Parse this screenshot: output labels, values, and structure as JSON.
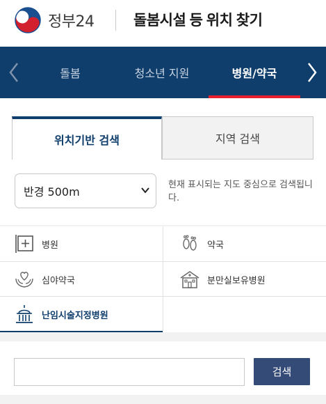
{
  "header": {
    "logo_text": "정부24",
    "title": "돌봄시설 등 위치 찾기"
  },
  "nav": {
    "left_arrow": "chevron-left-icon",
    "right_arrow": "chevron-right-icon",
    "tabs": [
      {
        "label": "돌봄",
        "active": false
      },
      {
        "label": "청소년 지원",
        "active": false
      },
      {
        "label": "병원/약국",
        "active": true
      }
    ]
  },
  "search": {
    "tabs": [
      {
        "label": "위치기반 검색",
        "active": true
      },
      {
        "label": "지역 검색",
        "active": false
      }
    ],
    "radius": {
      "selected": "반경 500m"
    },
    "hint": "현재 표시되는 지도 중심으로 검색됩니다."
  },
  "categories": [
    {
      "label": "병원",
      "icon": "hospital-cross-icon",
      "selected": false
    },
    {
      "label": "약국",
      "icon": "footprints-icon",
      "selected": false
    },
    {
      "label": "심야약국",
      "icon": "heart-hands-icon",
      "selected": false
    },
    {
      "label": "분만실보유병원",
      "icon": "building-icon",
      "selected": false
    },
    {
      "label": "난임시술지정병원",
      "icon": "dome-building-icon",
      "selected": true
    }
  ],
  "keyword": {
    "value": "",
    "button_label": "검색"
  },
  "colors": {
    "brand_navy": "#0f3e6c",
    "accent_red": "#e8202d",
    "button_blue": "#344a77"
  }
}
